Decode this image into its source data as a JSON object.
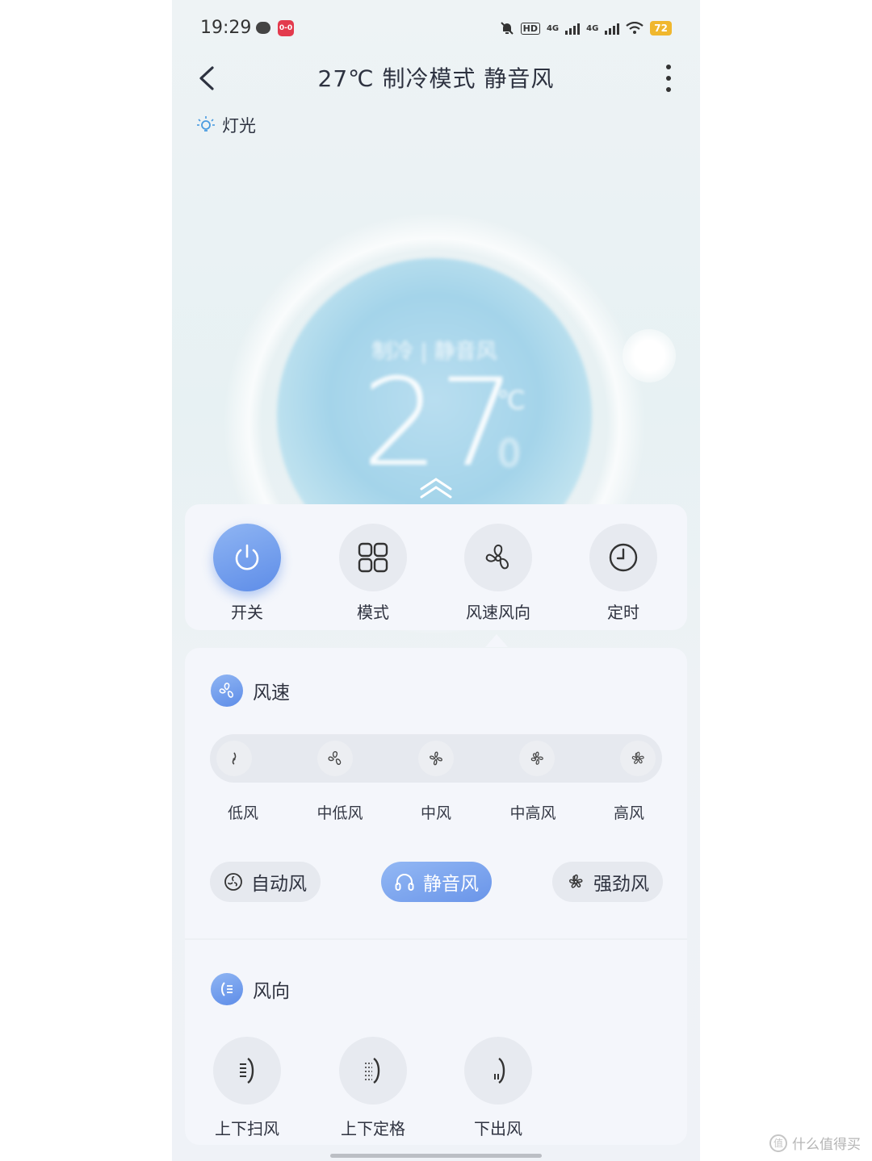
{
  "status_bar": {
    "time": "19:29",
    "app_badge": "0-0",
    "hd_label": "HD",
    "net1": "4G",
    "net2": "4G",
    "battery": "72"
  },
  "header": {
    "title": "27℃ 制冷模式 静音风"
  },
  "light": {
    "label": "灯光"
  },
  "dial": {
    "subtitle": "制冷 | 静音风",
    "temperature": "27",
    "unit": "℃",
    "decimal": "0"
  },
  "quick_actions": [
    {
      "label": "开关",
      "icon": "power-icon",
      "active": true
    },
    {
      "label": "模式",
      "icon": "grid-icon",
      "active": false
    },
    {
      "label": "风速风向",
      "icon": "fan-icon",
      "active": false
    },
    {
      "label": "定时",
      "icon": "clock-icon",
      "active": false
    }
  ],
  "wind_speed": {
    "title": "风速",
    "levels": [
      "低风",
      "中低风",
      "中风",
      "中高风",
      "高风"
    ],
    "modes": [
      {
        "label": "自动风",
        "icon": "auto-fan-icon",
        "active": false
      },
      {
        "label": "静音风",
        "icon": "headphones-icon",
        "active": true
      },
      {
        "label": "强劲风",
        "icon": "strong-fan-icon",
        "active": false
      }
    ]
  },
  "wind_direction": {
    "title": "风向",
    "items": [
      {
        "label": "上下扫风",
        "icon": "swing-vertical-icon"
      },
      {
        "label": "上下定格",
        "icon": "fixed-vertical-icon"
      },
      {
        "label": "下出风",
        "icon": "downward-air-icon"
      }
    ]
  },
  "watermark": {
    "text": "什么值得买",
    "logo": "值"
  },
  "colors": {
    "accent": "#6a95e9",
    "battery": "#f0b72e",
    "panel": "#f4f6fb"
  }
}
